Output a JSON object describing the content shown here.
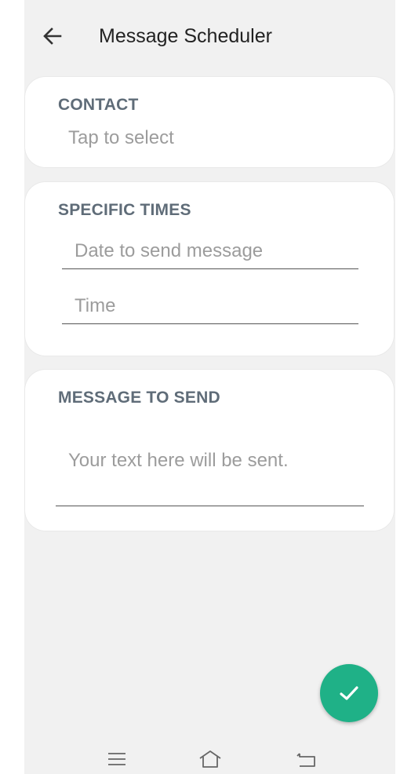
{
  "appbar": {
    "title": "Message Scheduler",
    "back_icon": "arrow-left-icon"
  },
  "contact": {
    "section_title": "CONTACT",
    "placeholder": "Tap to select"
  },
  "specific_times": {
    "section_title": "SPECIFIC TIMES",
    "date_placeholder": "Date to send message",
    "time_placeholder": "Time"
  },
  "message": {
    "section_title": "MESSAGE TO SEND",
    "placeholder": "Your text here will be sent."
  },
  "fab": {
    "icon": "checkmark-icon",
    "color": "#1fb187"
  },
  "navbar": {
    "icons": [
      "menu-icon",
      "home-icon",
      "back-icon"
    ]
  }
}
